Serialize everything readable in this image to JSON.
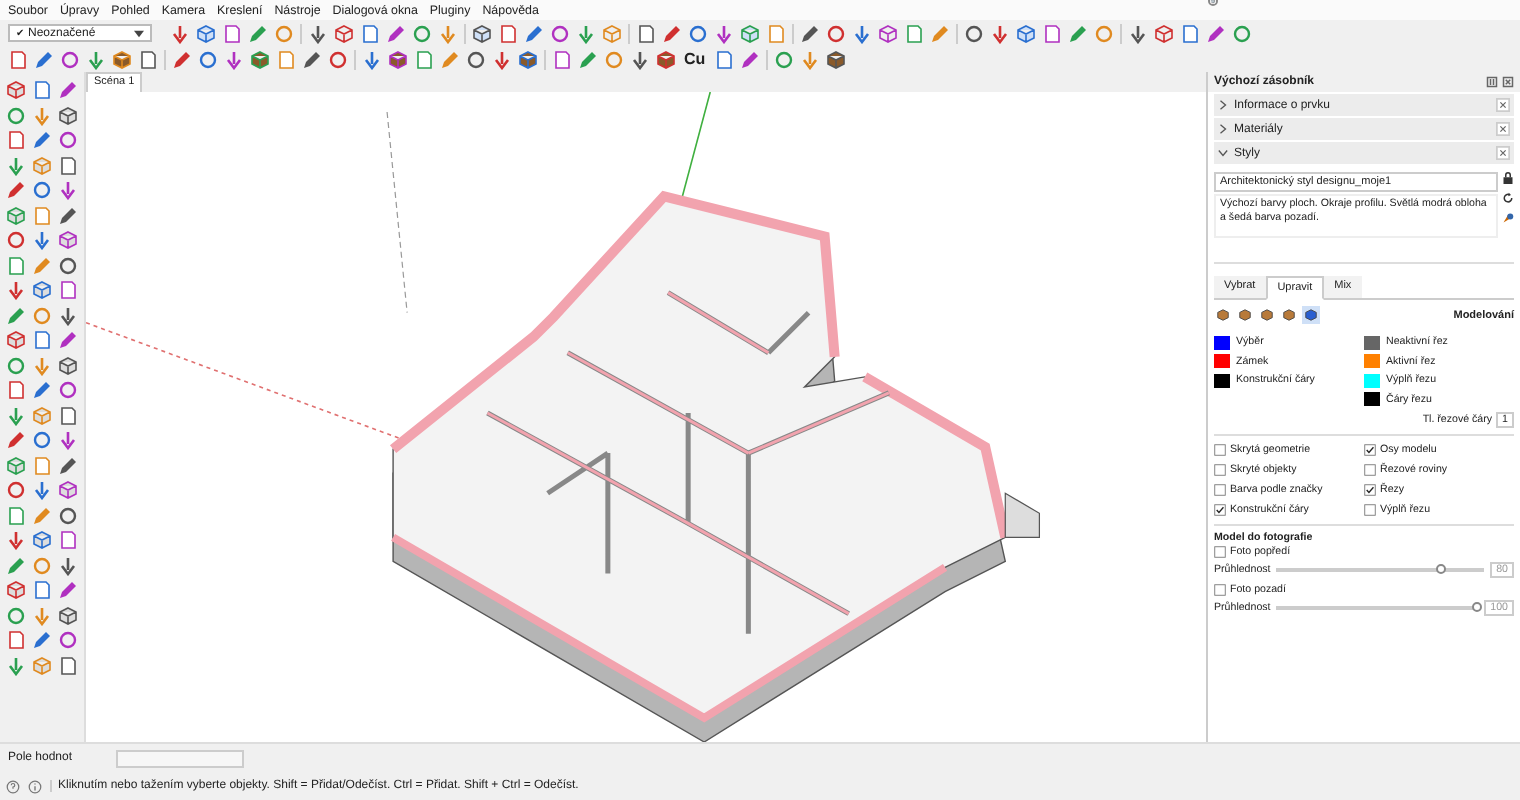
{
  "menu": [
    "Soubor",
    "Úpravy",
    "Pohled",
    "Kamera",
    "Kreslení",
    "Nástroje",
    "Dialogová okna",
    "Pluginy",
    "Nápověda"
  ],
  "toolbar": {
    "tag_dropdown": {
      "check": "✔",
      "value": "Neoznačené"
    },
    "text_tool": "Cu"
  },
  "scene_tab": {
    "label": "Scéna 1"
  },
  "panel": {
    "title": "Výchozí zásobník",
    "sections": [
      {
        "label": "Informace o prvku",
        "expanded": false
      },
      {
        "label": "Materiály",
        "expanded": false
      },
      {
        "label": "Styly",
        "expanded": true
      }
    ],
    "style": {
      "name": "Architektonický styl designu_moje1",
      "description": "Výchozí barvy ploch. Okraje profilu. Světlá modrá obloha a šedá barva pozadí."
    },
    "tabs": [
      {
        "label": "Vybrat",
        "selected": false
      },
      {
        "label": "Upravit",
        "selected": true
      },
      {
        "label": "Mix",
        "selected": false
      }
    ],
    "edit_heading": "Modelování",
    "colors": [
      {
        "label": "Výběr",
        "color": "#0000ff"
      },
      {
        "label": "Zámek",
        "color": "#ff0000"
      },
      {
        "label": "Konstrukční čáry",
        "color": "#000000"
      },
      {
        "label": "Neaktivní řez",
        "color": "#666666"
      },
      {
        "label": "Aktivní řez",
        "color": "#ff8000"
      },
      {
        "label": "Výplň řezu",
        "color": "#00ffff"
      },
      {
        "label": "Čáry řezu",
        "color": "#000000"
      }
    ],
    "section_line_width": {
      "label": "Tl. řezové čáry",
      "value": "1"
    },
    "checkboxes": [
      {
        "label": "Skrytá geometrie",
        "checked": false
      },
      {
        "label": "Osy modelu",
        "checked": true
      },
      {
        "label": "Skryté objekty",
        "checked": false
      },
      {
        "label": "Řezové roviny",
        "checked": false
      },
      {
        "label": "Barva podle značky",
        "checked": false
      },
      {
        "label": "Řezy",
        "checked": true
      },
      {
        "label": "Konstrukční čáry",
        "checked": true
      },
      {
        "label": "Výplň řezu",
        "checked": false
      }
    ],
    "photo": {
      "title": "Model do fotografie",
      "rows": [
        {
          "label": "Foto popředí",
          "checked": false,
          "slider_label": "Průhlednost",
          "level": 0.8,
          "value": "80",
          "disabled": true
        },
        {
          "label": "Foto pozadí",
          "checked": false,
          "slider_label": "Průhlednost",
          "level": 1,
          "value": "100",
          "disabled": true
        }
      ]
    }
  },
  "status": {
    "value_label": "Pole hodnot",
    "message": "Kliknutím nebo tažením vyberte objekty. Shift = Přidat/Odečíst. Ctrl = Přidat. Shift + Ctrl = Odečíst."
  }
}
